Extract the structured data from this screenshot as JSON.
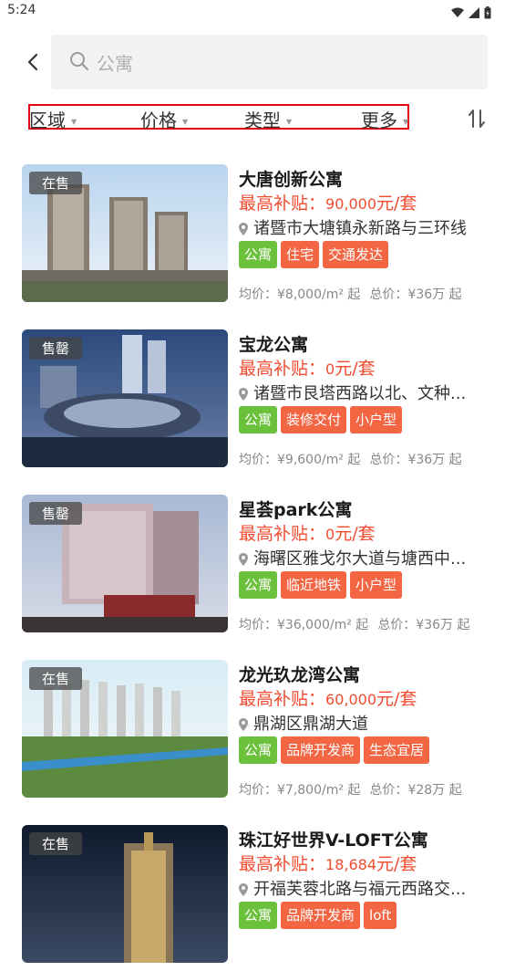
{
  "status_bar": {
    "time": "5:24"
  },
  "search": {
    "placeholder": "公寓"
  },
  "filters": [
    {
      "label": "区域"
    },
    {
      "label": "价格"
    },
    {
      "label": "类型"
    },
    {
      "label": "更多"
    }
  ],
  "subsidy_prefix": "最高补贴：",
  "listings": [
    {
      "status": "在售",
      "title": "大唐创新公寓",
      "subsidy_amount": "90,000",
      "subsidy_unit": "元/套",
      "address": "诸暨市大塘镇永新路与三环线",
      "tags": [
        "公寓",
        "住宅",
        "交通发达"
      ],
      "avg_price": "均价：¥8,000/m² 起",
      "total_price": "总价：¥36万 起"
    },
    {
      "status": "售罄",
      "title": "宝龙公寓",
      "subsidy_amount": "0",
      "subsidy_unit": "元/套",
      "address": "诸暨市艮塔西路以北、文种...",
      "tags": [
        "公寓",
        "装修交付",
        "小户型"
      ],
      "avg_price": "均价：¥9,600/m² 起",
      "total_price": "总价：¥36万 起"
    },
    {
      "status": "售罄",
      "title": "星荟park公寓",
      "subsidy_amount": "0",
      "subsidy_unit": "元/套",
      "address": "海曙区雅戈尔大道与塘西中...",
      "tags": [
        "公寓",
        "临近地铁",
        "小户型"
      ],
      "avg_price": "均价：¥36,000/m² 起",
      "total_price": "总价：¥36万 起"
    },
    {
      "status": "在售",
      "title": "龙光玖龙湾公寓",
      "subsidy_amount": "60,000",
      "subsidy_unit": "元/套",
      "address": "鼎湖区鼎湖大道",
      "tags": [
        "公寓",
        "品牌开发商",
        "生态宜居"
      ],
      "avg_price": "均价：¥7,800/m² 起",
      "total_price": "总价：¥28万 起"
    },
    {
      "status": "在售",
      "title": "珠江好世界V-LOFT公寓",
      "subsidy_amount": "18,684",
      "subsidy_unit": "元/套",
      "address": "开福芙蓉北路与福元西路交...",
      "tags": [
        "公寓",
        "品牌开发商",
        "loft"
      ]
    }
  ],
  "colors": {
    "accent_red": "#f04c30",
    "tag_green": "#6cc13c",
    "tag_orange": "#f26644",
    "filter_highlight": "#e60012"
  }
}
